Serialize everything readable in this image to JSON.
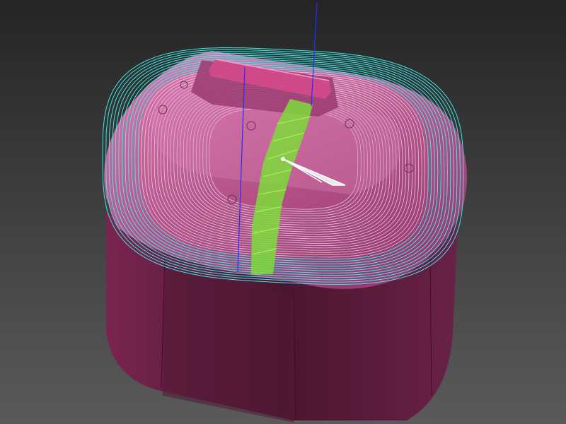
{
  "viewport": {
    "background_top": "#252525",
    "background_bottom": "#5a5a5a"
  },
  "part": {
    "body_color": "#5e1e3d",
    "body_shade": "#4a1630",
    "top_surface_color": "#c85a95",
    "boss_color": "#d04a8a"
  },
  "toolpath": {
    "pass_color_outer": "#3ff0f0",
    "pass_color_inner": "#f0f4ff",
    "leadin_color": "#7ddc3a",
    "leadin_highlight": "#c9ff6a"
  },
  "axes": {
    "z_axis_color": "#2a2aff",
    "tool_axis_color": "#ffffff"
  }
}
